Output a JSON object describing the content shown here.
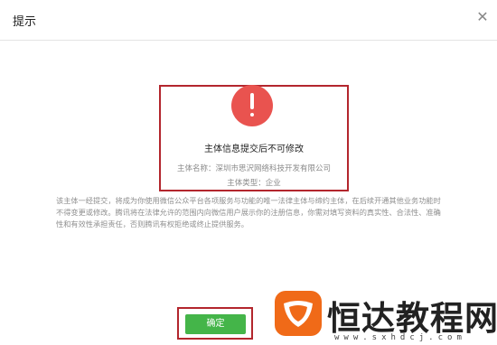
{
  "dialog": {
    "title": "提示",
    "close_glyph": "✕"
  },
  "notice_box": {
    "headline": "主体信息提交后不可修改",
    "entity_name": "主体名称：深圳市思沢网络科技开发有限公司",
    "entity_type": "主体类型：企业",
    "icon": "warning-exclamation-icon"
  },
  "description": "该主体一经提交，将成为你使用微信公众平台各项服务与功能的唯一法律主体与缔约主体，在后续开通其他业务功能时不得变更或修改。腾讯将在法律允许的范围内向微信用户展示你的注册信息，你需对填写资料的真实性、合法性、准确性和有效性承担责任，否则腾讯有权拒绝或终止提供服务。",
  "actions": {
    "confirm_label": "确定"
  },
  "watermark": {
    "text": "恒达教程网",
    "url": "www.sxhdcj.com"
  },
  "colors": {
    "highlight": "#b3262d",
    "warning": "#e9534f",
    "confirm": "#44b549",
    "watermark_logo": "#f06a18"
  }
}
